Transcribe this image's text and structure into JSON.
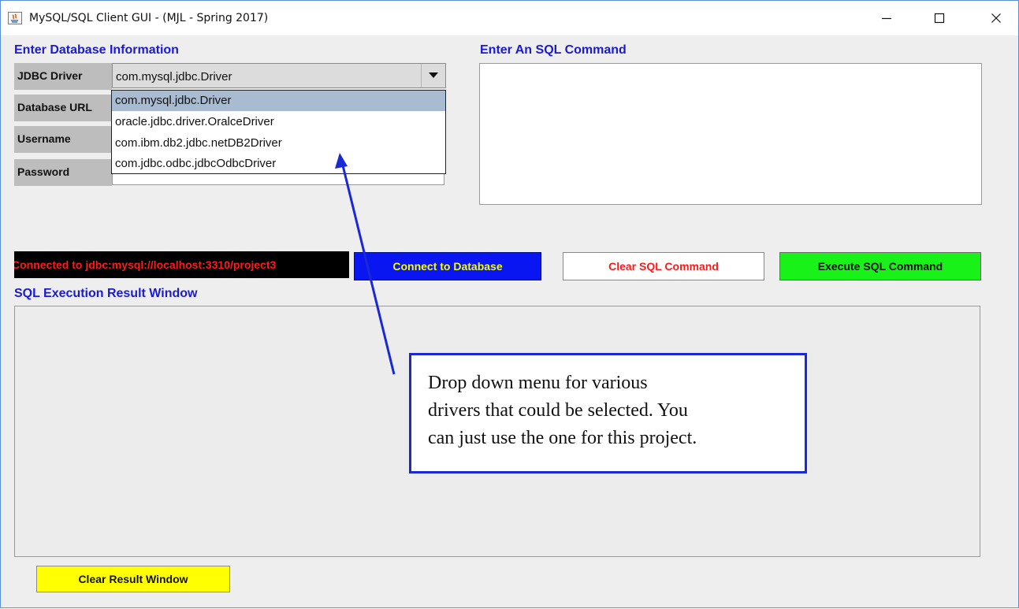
{
  "window": {
    "title": "MySQL/SQL Client GUI - (MJL - Spring 2017)",
    "controls": {
      "minimize": "—",
      "maximize": "☐",
      "close": "✕"
    }
  },
  "db_section": {
    "heading": "Enter Database Information",
    "fields": {
      "driver_label": "JDBC Driver",
      "url_label": "Database URL",
      "username_label": "Username",
      "password_label": "Password"
    },
    "driver_selected": "com.mysql.jdbc.Driver",
    "driver_options": [
      "com.mysql.jdbc.Driver",
      "oracle.jdbc.driver.OralceDriver",
      "com.ibm.db2.jdbc.netDB2Driver",
      "com.jdbc.odbc.jdbcOdbcDriver"
    ]
  },
  "sql_section": {
    "heading": "Enter An SQL Command",
    "command_value": ""
  },
  "status": {
    "text": "Connected to jdbc:mysql://localhost:3310/project3"
  },
  "buttons": {
    "connect": "Connect to Database",
    "clear_sql": "Clear SQL Command",
    "execute_sql": "Execute SQL Command",
    "clear_result": "Clear Result Window"
  },
  "result_section": {
    "heading": "SQL Execution Result Window"
  },
  "callout": {
    "lines": [
      "Drop down menu for various",
      "drivers that could be selected.  You",
      "can just use the one for this project."
    ]
  },
  "colors": {
    "heading_blue": "#1a1ad6",
    "connect_bg": "#0a16f2",
    "connect_fg": "#f5ff00",
    "clear_sql_fg": "#ff1a1a",
    "execute_bg": "#19f219",
    "clear_result_bg": "#ffff00",
    "status_fg": "#ff1a1a",
    "dropdown_selected_bg": "#a9bbd1"
  }
}
